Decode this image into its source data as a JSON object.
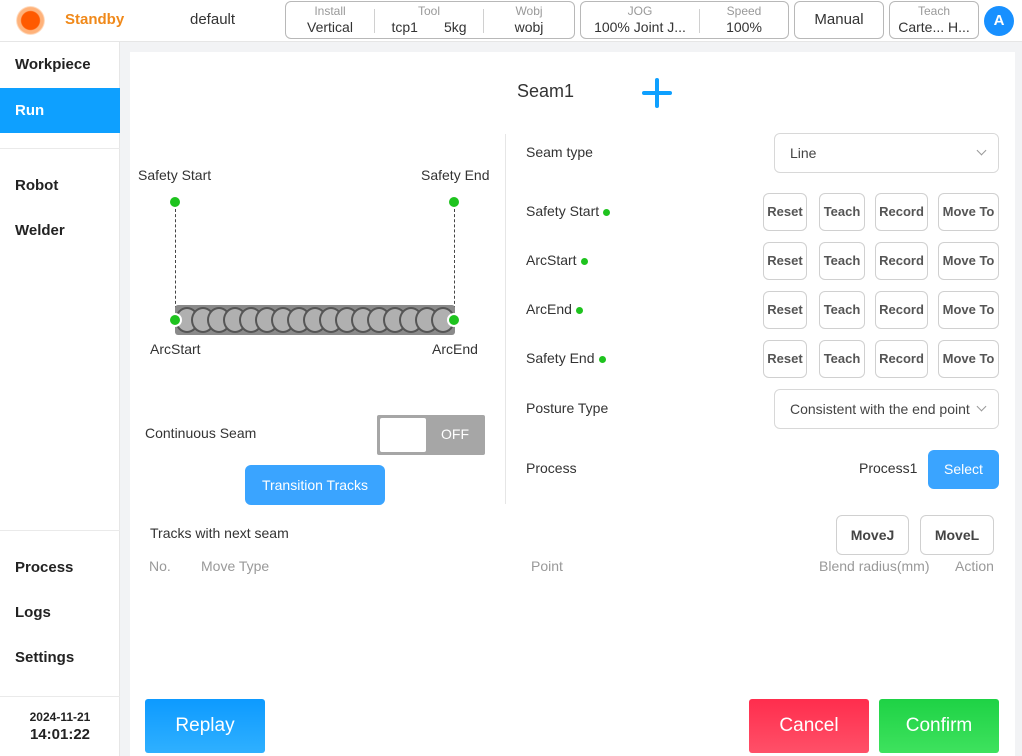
{
  "topbar": {
    "status": "Standby",
    "project": "default",
    "install": {
      "label": "Install",
      "value": "Vertical"
    },
    "tool": {
      "label": "Tool",
      "name": "tcp1",
      "load": "5kg"
    },
    "wobj": {
      "label": "Wobj",
      "value": "wobj"
    },
    "jog": {
      "label": "JOG",
      "percent": "100%",
      "mode": "Joint J..."
    },
    "speed": {
      "label": "Speed",
      "value": "100%"
    },
    "mode_button": "Manual",
    "teach": {
      "label": "Teach",
      "frame": "Carte...",
      "extra": "H..."
    },
    "avatar_letter": "A"
  },
  "sidebar": {
    "items": [
      {
        "label": "Workpiece"
      },
      {
        "label": "Run"
      },
      {
        "label": "Robot"
      },
      {
        "label": "Welder"
      },
      {
        "label": "Process"
      },
      {
        "label": "Logs"
      },
      {
        "label": "Settings"
      }
    ],
    "active": "Run",
    "date": "2024-11-21",
    "time": "14:01:22"
  },
  "seam": {
    "title": "Seam1",
    "diagram": {
      "safety_start": "Safety Start",
      "safety_end": "Safety End",
      "arc_start": "ArcStart",
      "arc_end": "ArcEnd"
    },
    "continuous_seam_label": "Continuous Seam",
    "continuous_seam_state": "OFF",
    "transition_tracks_button": "Transition Tracks",
    "seam_type_label": "Seam type",
    "seam_type_value": "Line",
    "points": [
      {
        "label": "Safety Start"
      },
      {
        "label": "ArcStart"
      },
      {
        "label": "ArcEnd"
      },
      {
        "label": "Safety End"
      }
    ],
    "point_buttons": {
      "reset": "Reset",
      "teach": "Teach",
      "record": "Record",
      "move_to": "Move To"
    },
    "posture_type_label": "Posture Type",
    "posture_type_value": "Consistent with the end point",
    "process_label": "Process",
    "process_value": "Process1",
    "select_button": "Select",
    "status_color": "#1ec31e"
  },
  "tracks": {
    "label": "Tracks with next seam",
    "movej_button": "MoveJ",
    "movel_button": "MoveL",
    "columns": {
      "no": "No.",
      "move_type": "Move Type",
      "point": "Point",
      "blend": "Blend radius(mm)",
      "action": "Action"
    }
  },
  "footer": {
    "replay": "Replay",
    "cancel": "Cancel",
    "confirm": "Confirm"
  }
}
